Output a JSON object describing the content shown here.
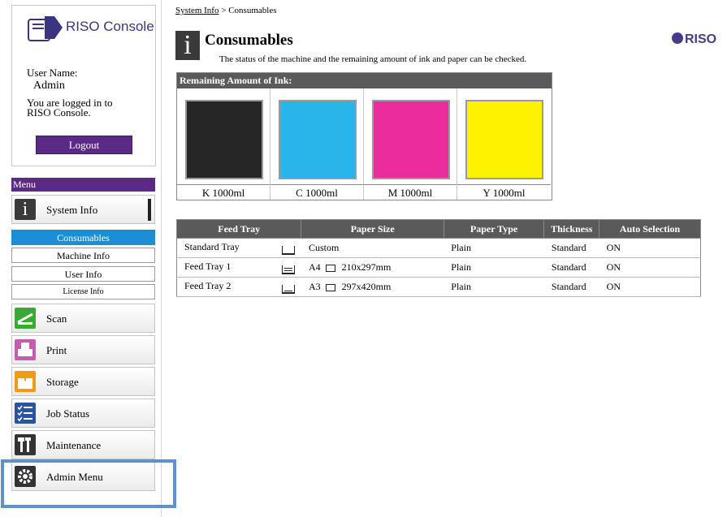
{
  "app": {
    "logo_text": "RISO Console",
    "brand": "RISO"
  },
  "login": {
    "user_name_label": "User Name:",
    "user_name": "Admin",
    "status_line1": "You are logged in to",
    "status_line2": "RISO Console.",
    "logout_label": "Logout"
  },
  "menu": {
    "title": "Menu",
    "items": [
      {
        "label": "System Info",
        "icon": "info-icon"
      },
      {
        "label": "Scan",
        "icon": "scan-icon"
      },
      {
        "label": "Print",
        "icon": "print-icon"
      },
      {
        "label": "Storage",
        "icon": "storage-icon"
      },
      {
        "label": "Job Status",
        "icon": "job-status-icon"
      },
      {
        "label": "Maintenance",
        "icon": "maintenance-icon"
      },
      {
        "label": "Admin Menu",
        "icon": "gear-icon"
      }
    ],
    "sub_items": [
      "Consumables",
      "Machine Info",
      "User Info",
      "License Info"
    ],
    "active_sub": "Consumables"
  },
  "breadcrumb": {
    "parent": "System Info",
    "separator": " > ",
    "current": "Consumables"
  },
  "page": {
    "title": "Consumables",
    "description": "The status of the machine and the remaining amount of ink and paper can be checked."
  },
  "ink": {
    "header": "Remaining Amount of Ink:",
    "items": [
      {
        "label": "K 1000ml",
        "color": "#262626"
      },
      {
        "label": "C 1000ml",
        "color": "#2ab5ea"
      },
      {
        "label": "M 1000ml",
        "color": "#ea2c9c"
      },
      {
        "label": "Y 1000ml",
        "color": "#fff200"
      }
    ]
  },
  "tray_table": {
    "headers": [
      "Feed Tray",
      "Paper Size",
      "Paper Type",
      "Thickness",
      "Auto Selection"
    ],
    "rows": [
      {
        "tray": "Standard Tray",
        "size_name": "Custom",
        "size_dims": "",
        "type": "Plain",
        "thickness": "Standard",
        "auto": "ON"
      },
      {
        "tray": "Feed Tray 1",
        "size_name": "A4",
        "size_dims": "210x297mm",
        "type": "Plain",
        "thickness": "Standard",
        "auto": "ON"
      },
      {
        "tray": "Feed Tray 2",
        "size_name": "A3",
        "size_dims": "297x420mm",
        "type": "Plain",
        "thickness": "Standard",
        "auto": "ON"
      }
    ]
  },
  "colors": {
    "menu_purple": "#5b2a86",
    "active_blue": "#1a8fd8",
    "header_gray": "#5a5a5a",
    "highlight_blue": "#5f92c9"
  }
}
